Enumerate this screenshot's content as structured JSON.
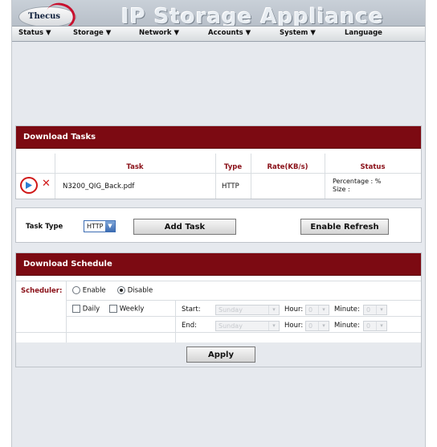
{
  "header": {
    "logo_text": "Thecus",
    "app_title": "IP Storage Appliance"
  },
  "menu": [
    {
      "label": "Status ▼"
    },
    {
      "label": "Storage ▼"
    },
    {
      "label": "Network ▼"
    },
    {
      "label": "Accounts ▼"
    },
    {
      "label": "System ▼"
    },
    {
      "label": "Language"
    }
  ],
  "download_tasks": {
    "title": "Download Tasks",
    "columns": {
      "task": "Task",
      "type": "Type",
      "rate": "Rate(KB/s)",
      "status": "Status"
    },
    "rows": [
      {
        "task": "N3200_QIG_Back.pdf",
        "type": "HTTP",
        "rate": "",
        "status_line1": "Percentage : %",
        "status_line2": "Size :"
      }
    ],
    "task_type_label": "Task Type",
    "task_type_value": "HTTP",
    "add_task_label": "Add Task",
    "enable_refresh_label": "Enable Refresh"
  },
  "download_schedule": {
    "title": "Download Schedule",
    "scheduler_label": "Scheduler:",
    "enable_label": "Enable",
    "disable_label": "Disable",
    "selected": "Disable",
    "daily_label": "Daily",
    "weekly_label": "Weekly",
    "start_label": "Start:",
    "end_label": "End:",
    "day_value": "Sunday",
    "hour_label": "Hour:",
    "hour_value": "0",
    "minute_label": "Minute:",
    "minute_value": "0",
    "apply_label": "Apply"
  },
  "colors": {
    "title_bar": "#7c0a12",
    "header_text": "#8a1018",
    "play_icon": "#2a7fd4",
    "delete_icon": "#d01818",
    "highlight_circle": "#d01818"
  }
}
